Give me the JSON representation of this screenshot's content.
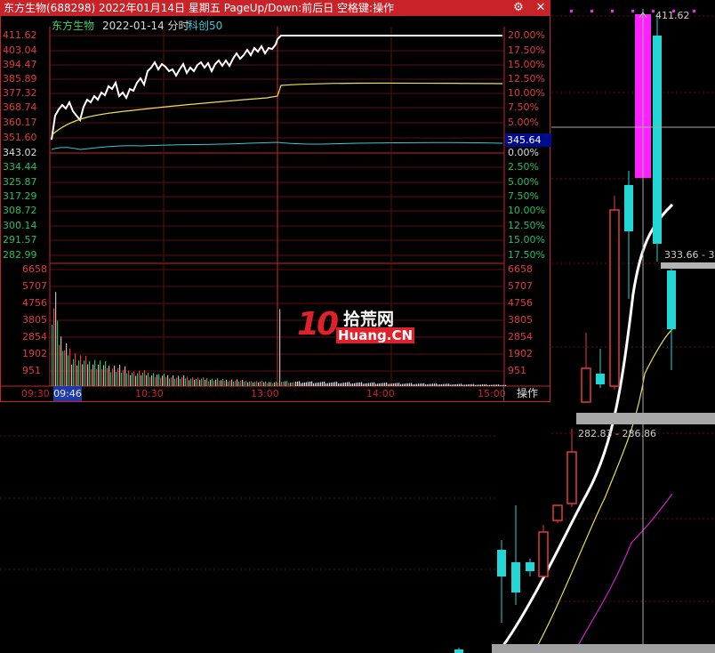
{
  "window": {
    "title": "东方生物(688298) 2022年01月14日 星期五 PageUp/Down:前后日 空格键:操作",
    "settings_icon": "gear-icon",
    "close_icon": "close-icon",
    "settings_glyph": "⚙",
    "close_glyph": "✕"
  },
  "chart_header": {
    "stock_name": "东方生物",
    "date_mode": "2022-01-14 分时",
    "index_name": "科创50"
  },
  "price_axis": {
    "left_labels": [
      "411.62",
      "403.04",
      "394.47",
      "385.89",
      "377.32",
      "368.74",
      "360.17",
      "351.60",
      "343.02",
      "334.44",
      "325.87",
      "317.29",
      "308.72",
      "300.14",
      "291.57",
      "282.99"
    ],
    "right_labels": [
      "20.00%",
      "17.50%",
      "15.00%",
      "12.50%",
      "10.00%",
      "7.50%",
      "5.00%",
      "2.50%",
      "0.00%",
      "2.50%",
      "5.00%",
      "7.50%",
      "10.00%",
      "12.50%",
      "15.00%",
      "17.50%"
    ],
    "current_value": "345.64"
  },
  "volume_axis": {
    "labels": [
      "6658",
      "5707",
      "4756",
      "3805",
      "2854",
      "1902",
      "951"
    ]
  },
  "time_axis": {
    "start": "09:30",
    "selected": "09:46",
    "labels": [
      "10:30",
      "13:00",
      "14:00",
      "15:00"
    ],
    "operate_button": "操作"
  },
  "kline_labels": {
    "high": "411.62",
    "mid_range": "333.66 - 3",
    "low_range": "282.83 - 286.86"
  },
  "watermark": {
    "logo_number": "10",
    "logo_cn": "拾荒网",
    "logo_en": "Huang.CN"
  },
  "colors": {
    "title_bar": "#c9232a",
    "up": "#e33b3b",
    "down": "#22d6d6",
    "neutral": "#ffffff",
    "avg_line": "#f0e24a",
    "index_line": "#38c8d8",
    "ma_white": "#ffffff",
    "ma_yellow": "#e8e050",
    "ma_magenta": "#d020d0",
    "highlight": "#ff20ff"
  }
}
